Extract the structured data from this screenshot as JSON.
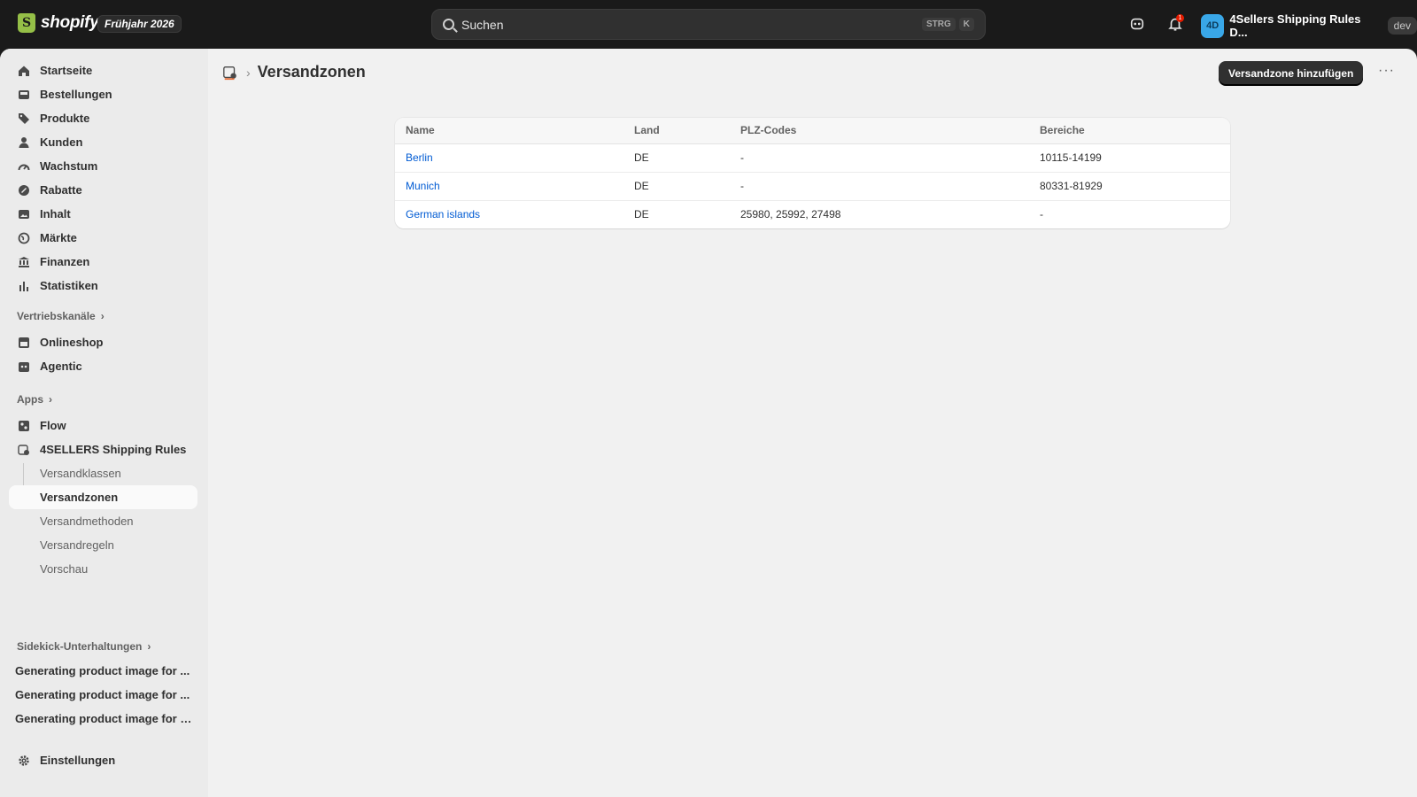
{
  "topbar": {
    "logo_text": "shopify",
    "edition": "Frühjahr 2026",
    "search_placeholder": "Suchen",
    "shortcut_1": "STRG",
    "shortcut_2": "K",
    "notification_count": "1",
    "avatar_initials": "4D",
    "store_name": "4Sellers Shipping Rules D...",
    "env_badge": "dev"
  },
  "sidebar": {
    "main": [
      {
        "label": "Startseite",
        "icon": "home-icon"
      },
      {
        "label": "Bestellungen",
        "icon": "inbox-icon"
      },
      {
        "label": "Produkte",
        "icon": "tag-icon"
      },
      {
        "label": "Kunden",
        "icon": "person-icon"
      },
      {
        "label": "Wachstum",
        "icon": "gauge-icon"
      },
      {
        "label": "Rabatte",
        "icon": "discount-icon"
      },
      {
        "label": "Inhalt",
        "icon": "image-icon"
      },
      {
        "label": "Märkte",
        "icon": "globe-icon"
      },
      {
        "label": "Finanzen",
        "icon": "bank-icon"
      },
      {
        "label": "Statistiken",
        "icon": "bar-chart-icon"
      }
    ],
    "sales_channels_heading": "Vertriebskanäle",
    "sales_channels": [
      {
        "label": "Onlineshop",
        "icon": "store-icon"
      },
      {
        "label": "Agentic",
        "icon": "robot-icon"
      }
    ],
    "apps_heading": "Apps",
    "apps": [
      {
        "label": "Flow",
        "icon": "flow-icon"
      },
      {
        "label": "4SELLERS Shipping Rules",
        "icon": "app-icon"
      }
    ],
    "app_subitems": [
      "Versandklassen",
      "Versandzonen",
      "Versandmethoden",
      "Versandregeln",
      "Vorschau"
    ],
    "sidekick_heading": "Sidekick-Unterhaltungen",
    "sidekick_items": [
      "Generating product image for ...",
      "Generating product image for ...",
      "Generating product image for t..."
    ],
    "settings_label": "Einstellungen"
  },
  "page": {
    "title": "Versandzonen",
    "primary_action": "Versandzone hinzufügen",
    "more_label": "···"
  },
  "table": {
    "headers": [
      "Name",
      "Land",
      "PLZ-Codes",
      "Bereiche"
    ],
    "rows": [
      {
        "name": "Berlin",
        "country": "DE",
        "zip_codes": "-",
        "ranges": "10115-14199"
      },
      {
        "name": "Munich",
        "country": "DE",
        "zip_codes": "-",
        "ranges": "80331-81929"
      },
      {
        "name": "German islands",
        "country": "DE",
        "zip_codes": "25980, 25992, 27498",
        "ranges": "-"
      }
    ]
  },
  "colors": {
    "accent_link": "#005bd3",
    "topbar_bg": "#1a1a1a",
    "primary_button": "#303030",
    "avatar_bg": "#39a7e8"
  }
}
